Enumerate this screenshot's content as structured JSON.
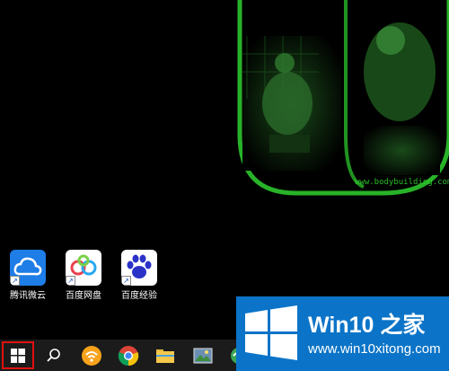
{
  "desktop": {
    "icons": [
      {
        "label": "腾讯微云",
        "icon": "weiyun-cloud-icon"
      },
      {
        "label": "百度网盘",
        "icon": "baidu-netdisk-icon"
      },
      {
        "label": "百度经验",
        "icon": "baidu-paw-icon"
      }
    ],
    "wallpaper_text": "www.bodybuilding.com"
  },
  "taskbar": {
    "items": [
      {
        "name": "start",
        "icon": "windows-logo-icon",
        "highlighted": true
      },
      {
        "name": "search",
        "icon": "search-icon"
      },
      {
        "name": "wifi-app",
        "icon": "wifi-app-icon"
      },
      {
        "name": "chrome",
        "icon": "chrome-icon"
      },
      {
        "name": "file-explorer",
        "icon": "folder-icon"
      },
      {
        "name": "photo-app",
        "icon": "image-icon"
      },
      {
        "name": "browser",
        "icon": "browser-icon"
      }
    ]
  },
  "watermark": {
    "title": "Win10 之家",
    "url": "www.win10xitong.com"
  },
  "colors": {
    "start_highlight": "#e01010",
    "watermark_bg": "#0b74c8",
    "wallpaper_green": "#2fd12f"
  }
}
